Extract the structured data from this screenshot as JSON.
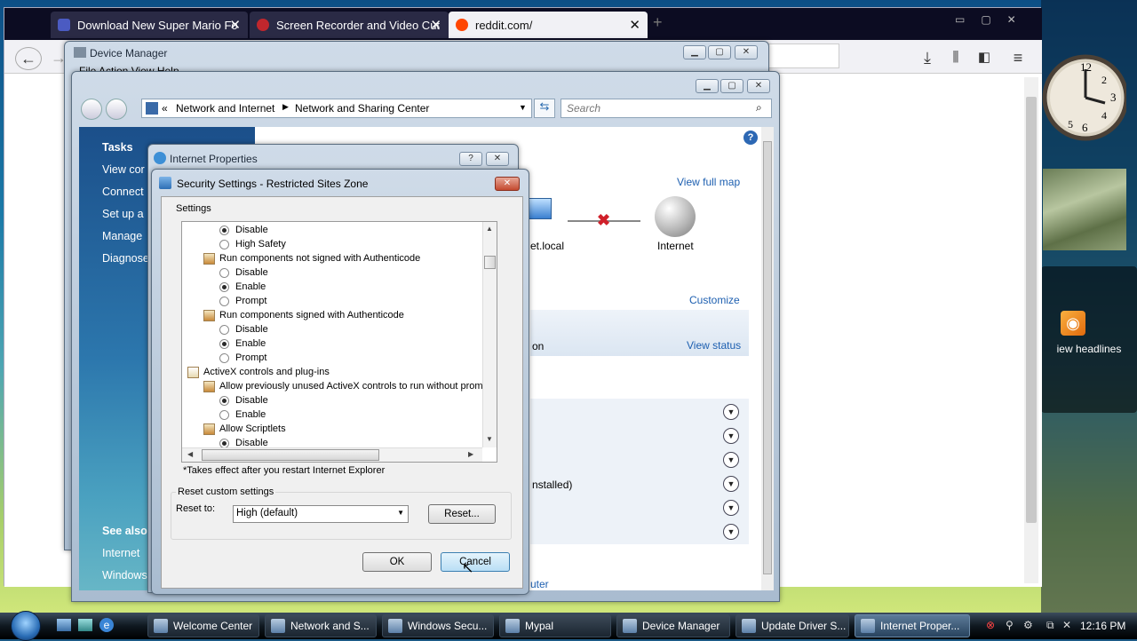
{
  "browser": {
    "tabs": [
      {
        "title": "Download New Super Mario Fo",
        "color": "#4b5bc2"
      },
      {
        "title": "Screen Recorder and Video Cut",
        "color": "#c0272d"
      },
      {
        "title": "reddit.com/",
        "color": "#ff4500"
      }
    ],
    "new_tab": "+"
  },
  "device_manager": {
    "title": "Device Manager",
    "menu": "File  Action  View  Help"
  },
  "nsc": {
    "breadcrumb": [
      "«",
      "Network and Internet",
      "Network and Sharing Center"
    ],
    "search_placeholder": "Search",
    "tasks_heading": "Tasks",
    "tasks": [
      "View cor",
      "Connect",
      "Set up a",
      "Manage",
      "Diagnose"
    ],
    "see_also_heading": "See also",
    "see_also": [
      "Internet",
      "Windows"
    ],
    "view_full_map": "View full map",
    "node_local": "et.local",
    "node_internet": "Internet",
    "customize": "Customize",
    "view_status": "View status",
    "row_partial": "on",
    "row_installed": "nstalled)",
    "bottom_link": "uter"
  },
  "internet_properties": {
    "title": "Internet Properties"
  },
  "security": {
    "title": "Security Settings - Restricted Sites Zone",
    "settings_label": "Settings",
    "tree": [
      {
        "type": "radio",
        "label": "Disable",
        "on": true,
        "indent": 2
      },
      {
        "type": "radio",
        "label": "High Safety",
        "on": false,
        "indent": 2
      },
      {
        "type": "item",
        "label": "Run components not signed with Authenticode",
        "indent": 1
      },
      {
        "type": "radio",
        "label": "Disable",
        "on": false,
        "indent": 2
      },
      {
        "type": "radio",
        "label": "Enable",
        "on": true,
        "indent": 2
      },
      {
        "type": "radio",
        "label": "Prompt",
        "on": false,
        "indent": 2
      },
      {
        "type": "item",
        "label": "Run components signed with Authenticode",
        "indent": 1
      },
      {
        "type": "radio",
        "label": "Disable",
        "on": false,
        "indent": 2
      },
      {
        "type": "radio",
        "label": "Enable",
        "on": true,
        "indent": 2
      },
      {
        "type": "radio",
        "label": "Prompt",
        "on": false,
        "indent": 2
      },
      {
        "type": "group",
        "label": "ActiveX controls and plug-ins",
        "indent": 0
      },
      {
        "type": "item",
        "label": "Allow previously unused ActiveX controls to run without prom",
        "indent": 1
      },
      {
        "type": "radio",
        "label": "Disable",
        "on": true,
        "indent": 2
      },
      {
        "type": "radio",
        "label": "Enable",
        "on": false,
        "indent": 2
      },
      {
        "type": "item",
        "label": "Allow Scriptlets",
        "indent": 1
      },
      {
        "type": "radio",
        "label": "Disable",
        "on": true,
        "indent": 2
      }
    ],
    "note": "*Takes effect after you restart Internet Explorer",
    "reset_group": "Reset custom settings",
    "reset_to_label": "Reset to:",
    "reset_value": "High (default)",
    "reset_button": "Reset...",
    "ok": "OK",
    "cancel": "Cancel"
  },
  "gadgets": {
    "feed_text": "iew headlines"
  },
  "taskbar": {
    "items": [
      {
        "label": "Welcome Center",
        "active": false
      },
      {
        "label": "Network and S...",
        "active": false
      },
      {
        "label": "Windows Secu...",
        "active": false
      },
      {
        "label": "Mypal",
        "active": false
      },
      {
        "label": "Device Manager",
        "active": false
      },
      {
        "label": "Update Driver S...",
        "active": false
      },
      {
        "label": "Internet Proper...",
        "active": true
      }
    ],
    "clock": "12:16 PM"
  }
}
